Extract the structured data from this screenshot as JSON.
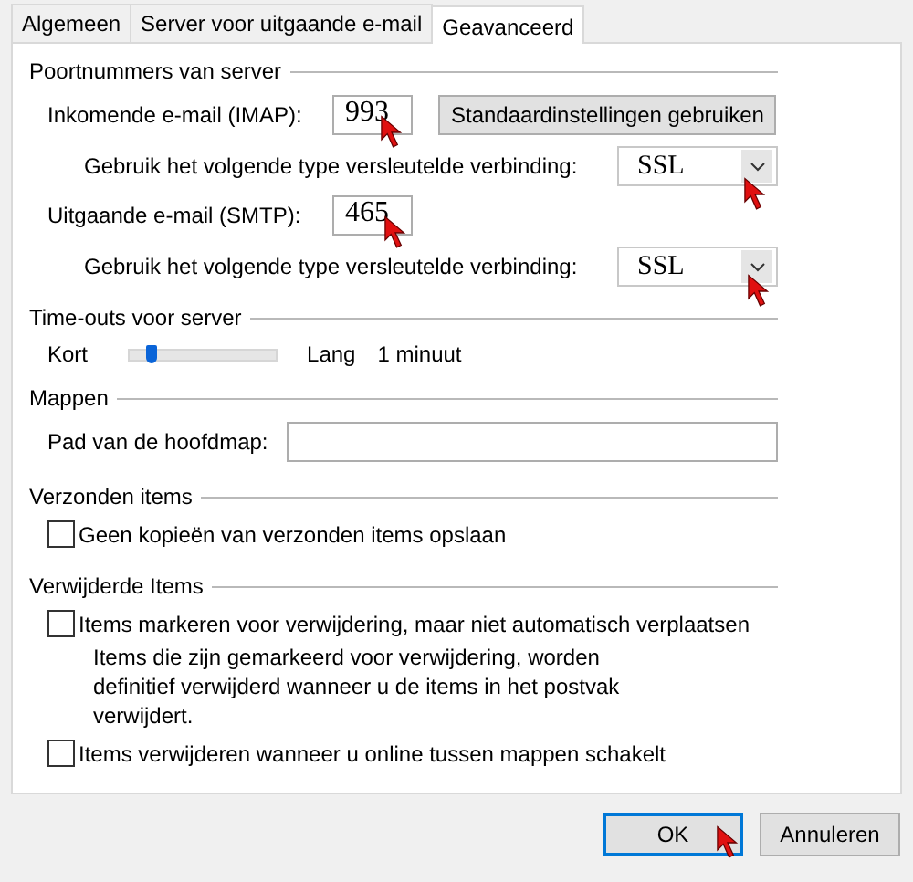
{
  "tabs": [
    {
      "label": "Algemeen",
      "selected": false
    },
    {
      "label": "Server voor uitgaande e-mail",
      "selected": false
    },
    {
      "label": "Geavanceerd",
      "selected": true
    }
  ],
  "ports": {
    "title": "Poortnummers van server",
    "incoming": {
      "label": "Inkomende e-mail (IMAP):",
      "value": "993"
    },
    "defaults_button": "Standaardinstellingen gebruiken",
    "incoming_encryption": {
      "label": "Gebruik het volgende type versleutelde verbinding:",
      "value": "SSL"
    },
    "outgoing": {
      "label": "Uitgaande e-mail (SMTP):",
      "value": "465"
    },
    "outgoing_encryption": {
      "label": "Gebruik het volgende type versleutelde verbinding:",
      "value": "SSL"
    }
  },
  "timeouts": {
    "title": "Time-outs voor server",
    "min_label": "Kort",
    "max_label": "Lang",
    "level": 0.15,
    "reading": "1 minuut"
  },
  "folders": {
    "title": "Mappen",
    "root_label": "Pad van de hoofdmap:"
  },
  "sent": {
    "title": "Verzonden items",
    "options": [
      {
        "label": "Geen kopieën van verzonden items opslaan",
        "checked": false
      }
    ]
  },
  "deleted": {
    "title": "Verwijderde Items",
    "options": [
      {
        "label": "Items markeren voor verwijdering, maar niet automatisch verplaatsen",
        "checked": false,
        "note": "Items die zijn gemarkeerd voor verwijdering, worden definitief verwijderd wanneer u de items in het postvak verwijdert."
      },
      {
        "label": "Items verwijderen wanneer u online tussen mappen schakelt",
        "checked": false
      }
    ]
  },
  "buttons": [
    {
      "label": "OK",
      "default": true
    },
    {
      "label": "Annuleren",
      "default": false
    }
  ]
}
